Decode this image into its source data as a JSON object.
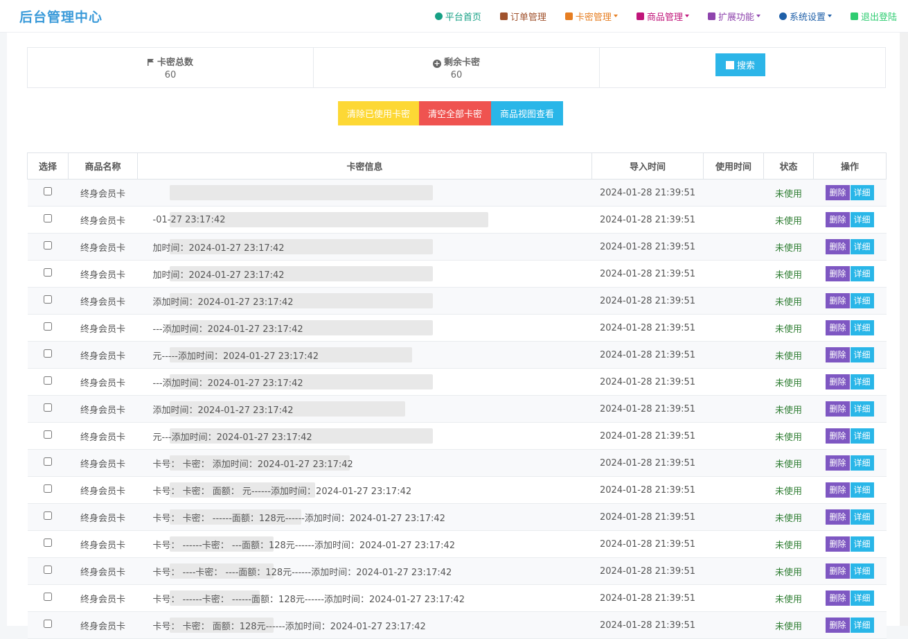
{
  "brand": "后台管理中心",
  "nav": [
    {
      "label": "平台首页",
      "icon": "user-icon",
      "color": "#16a085",
      "caret": false
    },
    {
      "label": "订单管理",
      "icon": "calendar-icon",
      "color": "#a0522d",
      "caret": false
    },
    {
      "label": "卡密管理",
      "icon": "list-icon",
      "color": "#e67e22",
      "caret": true
    },
    {
      "label": "商品管理",
      "icon": "list-icon",
      "color": "#c0157a",
      "caret": true
    },
    {
      "label": "扩展功能",
      "icon": "list-icon",
      "color": "#8e44ad",
      "caret": true
    },
    {
      "label": "系统设置",
      "icon": "gear-icon",
      "color": "#1e5fa8",
      "caret": true
    },
    {
      "label": "退出登陆",
      "icon": "logout-icon",
      "color": "#2ecc71",
      "caret": false
    }
  ],
  "stats": {
    "total_label": "卡密总数",
    "total_value": "60",
    "remain_label": "剩余卡密",
    "remain_value": "60",
    "search_label": "搜索"
  },
  "actions": {
    "clear_used": "清除已使用卡密",
    "clear_all": "清空全部卡密",
    "goods_view": "商品视图查看"
  },
  "table": {
    "headers": [
      "选择",
      "商品名称",
      "卡密信息",
      "导入时间",
      "使用时间",
      "状态",
      "操作"
    ],
    "rows": [
      {
        "product": "终身会员卡",
        "card": "",
        "import_time": "2024-01-28 21:39:51",
        "use_time": "",
        "status": "未使用"
      },
      {
        "product": "终身会员卡",
        "card": "-01-27 23:17:42",
        "import_time": "2024-01-28 21:39:51",
        "use_time": "",
        "status": "未使用"
      },
      {
        "product": "终身会员卡",
        "card": "加时间：2024-01-27 23:17:42",
        "import_time": "2024-01-28 21:39:51",
        "use_time": "",
        "status": "未使用"
      },
      {
        "product": "终身会员卡",
        "card": "加时间：2024-01-27 23:17:42",
        "import_time": "2024-01-28 21:39:51",
        "use_time": "",
        "status": "未使用"
      },
      {
        "product": "终身会员卡",
        "card": "添加时间：2024-01-27 23:17:42",
        "import_time": "2024-01-28 21:39:51",
        "use_time": "",
        "status": "未使用"
      },
      {
        "product": "终身会员卡",
        "card": "---添加时间：2024-01-27 23:17:42",
        "import_time": "2024-01-28 21:39:51",
        "use_time": "",
        "status": "未使用"
      },
      {
        "product": "终身会员卡",
        "card": "元-----添加时间：2024-01-27 23:17:42",
        "import_time": "2024-01-28 21:39:51",
        "use_time": "",
        "status": "未使用"
      },
      {
        "product": "终身会员卡",
        "card": "---添加时间：2024-01-27 23:17:42",
        "import_time": "2024-01-28 21:39:51",
        "use_time": "",
        "status": "未使用"
      },
      {
        "product": "终身会员卡",
        "card": "添加时间：2024-01-27 23:17:42",
        "import_time": "2024-01-28 21:39:51",
        "use_time": "",
        "status": "未使用"
      },
      {
        "product": "终身会员卡",
        "card": "元---添加时间：2024-01-27 23:17:42",
        "import_time": "2024-01-28 21:39:51",
        "use_time": "",
        "status": "未使用"
      },
      {
        "product": "终身会员卡",
        "card": "卡号：        卡密：        添加时间：2024-01-27 23:17:42",
        "import_time": "2024-01-28 21:39:51",
        "use_time": "",
        "status": "未使用"
      },
      {
        "product": "终身会员卡",
        "card": "卡号：        卡密：    面额：  元------添加时间：2024-01-27 23:17:42",
        "import_time": "2024-01-28 21:39:51",
        "use_time": "",
        "status": "未使用"
      },
      {
        "product": "终身会员卡",
        "card": "卡号：        卡密：        ------面额：128元------添加时间：2024-01-27 23:17:42",
        "import_time": "2024-01-28 21:39:51",
        "use_time": "",
        "status": "未使用"
      },
      {
        "product": "终身会员卡",
        "card": "卡号：        ------卡密：        ---面额：128元------添加时间：2024-01-27 23:17:42",
        "import_time": "2024-01-28 21:39:51",
        "use_time": "",
        "status": "未使用"
      },
      {
        "product": "终身会员卡",
        "card": "卡号：        ----卡密：        ----面额：128元------添加时间：2024-01-27 23:17:42",
        "import_time": "2024-01-28 21:39:51",
        "use_time": "",
        "status": "未使用"
      },
      {
        "product": "终身会员卡",
        "card": "卡号：        ------卡密：        ------面额：128元------添加时间：2024-01-27 23:17:42",
        "import_time": "2024-01-28 21:39:51",
        "use_time": "",
        "status": "未使用"
      },
      {
        "product": "终身会员卡",
        "card": "卡号：        卡密：        面额：128元------添加时间：2024-01-27 23:17:42",
        "import_time": "2024-01-28 21:39:51",
        "use_time": "",
        "status": "未使用"
      }
    ],
    "delete_label": "删除",
    "detail_label": "详细"
  }
}
